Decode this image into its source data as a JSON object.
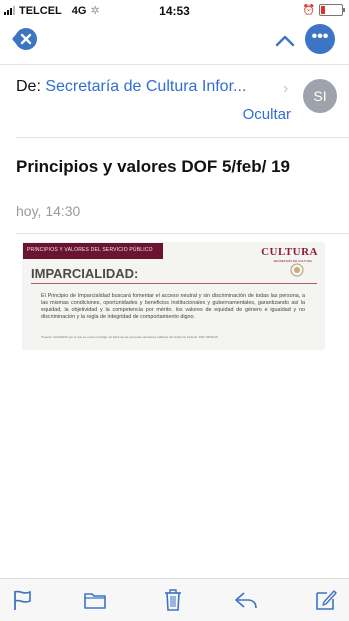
{
  "status": {
    "carrier": "TELCEL",
    "network": "4G",
    "time": "14:53"
  },
  "email": {
    "from_label": "De:",
    "sender": "Secretaría de Cultura Infor...",
    "avatar_initials": "SI",
    "hide_label": "Ocultar",
    "subject": "Principios y valores DOF 5/feb/ 19",
    "date": "hoy, 14:30"
  },
  "attachment": {
    "header_strip": "PRINCIPIOS Y VALORES DEL SERVICIO PÚBLICO",
    "brand": "CULTURA",
    "brand_sub": "SECRETARÍA DE CULTURA",
    "heading": "IMPARCIALIDAD:",
    "body": "El Principio de Imparcialidad buscará fomentar el acceso neutral y sin discriminación de todas las persona, a las mismas condiciones, oportunidades y beneficios institucionales y gubernamentales, garantizando así la equidad, la objetividad y la competencia por mérito. los valores de equidad de género e igualdad y no discriminación y la regla de integridad de comportamiento digno.",
    "note": "*Fuente: ACUERDO por el que se emite el Código de Ética de las personas servidoras públicas del Gobierno Federal. DOF 05/02/19.",
    "colors": {
      "accent": "#6b1430",
      "brand": "#8b1d3a"
    }
  },
  "icons": {
    "close": "close-icon",
    "up": "chevron-up-icon",
    "more": "ellipsis-icon",
    "flag": "flag-icon",
    "folder": "folder-icon",
    "trash": "trash-icon",
    "reply": "reply-icon",
    "compose": "compose-icon"
  },
  "colors": {
    "link": "#2f6fd1",
    "nav_button": "#3d74c4",
    "avatar": "#9fa3ac"
  }
}
